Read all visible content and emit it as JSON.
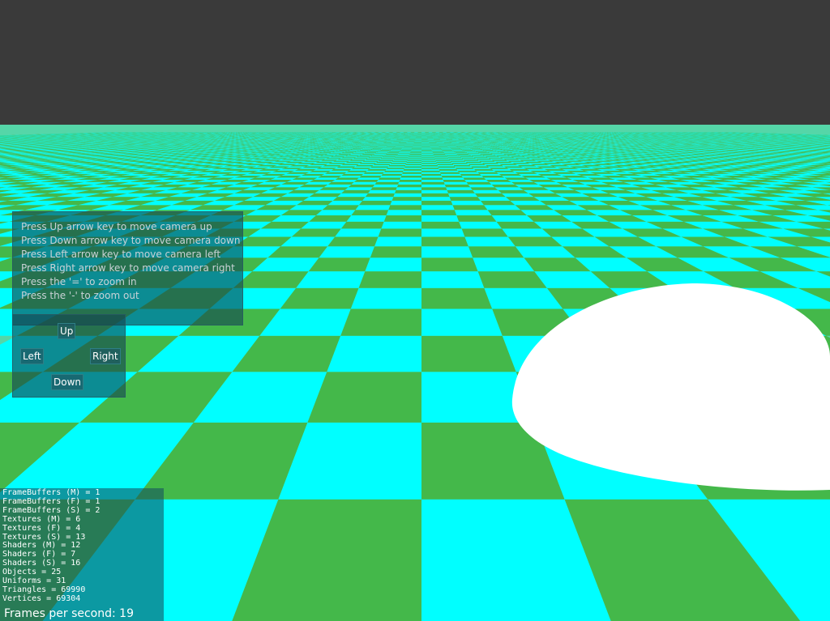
{
  "scene": {
    "sky_color": "#3a3a3a",
    "tile_color_a": "#00ffff",
    "tile_color_b": "#44b84a",
    "dome_color": "#ffffff"
  },
  "instructions": [
    "Press Up arrow key to move camera up",
    "Press Down arrow key to move camera down",
    "Press Left arrow key to move camera left",
    "Press Right arrow key to move camera right",
    "Press the '=' to zoom in",
    "Press the '-' to zoom out"
  ],
  "nav": {
    "up": "Up",
    "left": "Left",
    "right": "Right",
    "down": "Down"
  },
  "stats": [
    "FrameBuffers (M) = 1",
    "FrameBuffers (F) = 1",
    "FrameBuffers (S) = 2",
    "Textures (M) = 6",
    "Textures (F) = 4",
    "Textures (S) = 13",
    "Shaders (M) = 12",
    "Shaders (F) = 7",
    "Shaders (S) = 16",
    "Objects = 25",
    "Uniforms = 31",
    "Triangles = 69990",
    "Vertices = 69304"
  ],
  "fps": "Frames per second: 19"
}
